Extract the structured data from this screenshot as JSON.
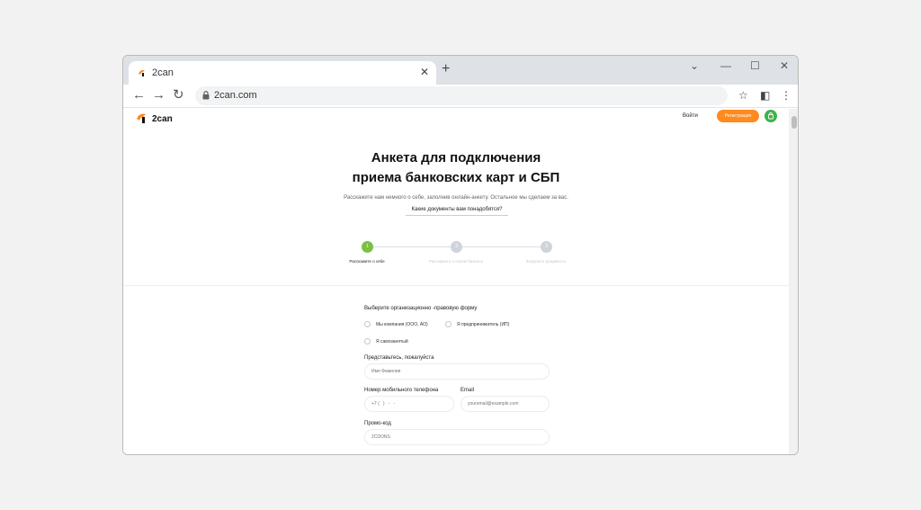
{
  "browser": {
    "tab_title": "2can",
    "url": "2can.com",
    "new_tab_glyph": "+",
    "tab_close_glyph": "✕",
    "controls": {
      "dropdown": "⌄",
      "minimize": "—",
      "maximize": "☐",
      "close": "✕"
    },
    "nav": {
      "back": "←",
      "forward": "→",
      "reload": "↻"
    },
    "toolbar_right": {
      "bookmark": "☆",
      "sidepanel": "◧",
      "menu": "⋮"
    },
    "colors": {
      "tabbar": "#dee1e6",
      "omnibox": "#f1f3f4"
    }
  },
  "site": {
    "logo_text": "2can",
    "header": {
      "login": "Войти",
      "register": "Регистрация"
    },
    "hero": {
      "title_line1": "Анкета для подключения",
      "title_line2": "приема банковских карт и СБП",
      "subtitle": "Расскажите нам немного о себе, заполнив онлайн-анкету. Остальное мы сделаем за вас.",
      "docs_link": "Какие документы вам понадобятся?"
    },
    "steps": [
      {
        "number": "1",
        "label": "Расскажите о себе",
        "active": true
      },
      {
        "number": "2",
        "label": "Расскажите о своем бизнесе",
        "active": false
      },
      {
        "number": "3",
        "label": "Загрузите документы",
        "active": false
      }
    ],
    "form": {
      "org_form_label": "Выберите организационно -правовую форму",
      "org_options": [
        "Мы компания (ООО, АО)",
        "Я предприниматель (ИП)",
        "Я самозанятый"
      ],
      "name_label": "Представьтесь, пожалуйста",
      "name_placeholder": "Имя Фамилия",
      "phone_label": "Номер мобильного телефона",
      "phone_placeholder": "+7 (   )   -   -",
      "email_label": "Email",
      "email_placeholder": "youremail@example.com",
      "promo_label": "Промо-код",
      "promo_placeholder": "2CDONS"
    },
    "colors": {
      "accent_orange": "#ff8a1f",
      "accent_green": "#3cb44b",
      "step_active": "#7bc043",
      "step_inactive": "#cfd4db"
    }
  }
}
